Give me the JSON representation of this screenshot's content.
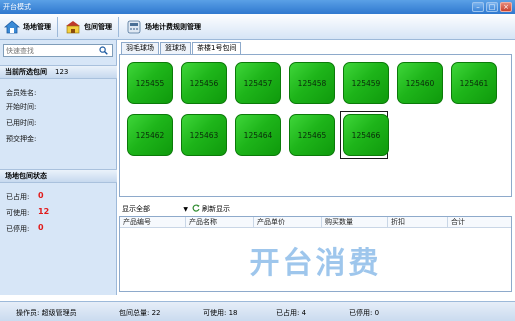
{
  "window": {
    "title": "开台模式"
  },
  "toolbar": {
    "venue_manage": "场地管理",
    "room_manage": "包间管理",
    "billing_rules": "场地计费规则管理"
  },
  "left": {
    "search_placeholder": "快速查找",
    "current_room_label": "当前所选包间",
    "current_room_value": "123",
    "fields": [
      "会员姓名:",
      "开始时间:",
      "已用时间:",
      "预交押金:"
    ],
    "status_title": "场地包间状态",
    "status": [
      {
        "label": "已占用:",
        "value": "0"
      },
      {
        "label": "可使用:",
        "value": "12"
      },
      {
        "label": "已停用:",
        "value": "0"
      }
    ]
  },
  "tabs": [
    "羽毛球场",
    "篮球场",
    "茶楼1号包间"
  ],
  "active_tab": 2,
  "rooms": [
    "125455",
    "125456",
    "125457",
    "125458",
    "125459",
    "125460",
    "125461",
    "125462",
    "125463",
    "125464",
    "125465",
    "125466"
  ],
  "selected_room": "125466",
  "controls": {
    "display_option": "显示全部",
    "refresh_label": "刷新显示"
  },
  "grid": {
    "columns": [
      "产品编号",
      "产品名称",
      "产品单价",
      "购买数量",
      "折扣",
      "合计"
    ],
    "watermark": "开台消费"
  },
  "statusbar": {
    "operator": "操作员: 超级管理员",
    "total": "包间总量: 22",
    "available": "可使用: 18",
    "occupied": "已占用: 4",
    "disabled": "已停用: 0"
  },
  "colors": {
    "room_green": "#1eb51a",
    "status_red": "#e01b1b",
    "watermark": "#9ec6ec",
    "titlebar": "#2f78cf"
  }
}
